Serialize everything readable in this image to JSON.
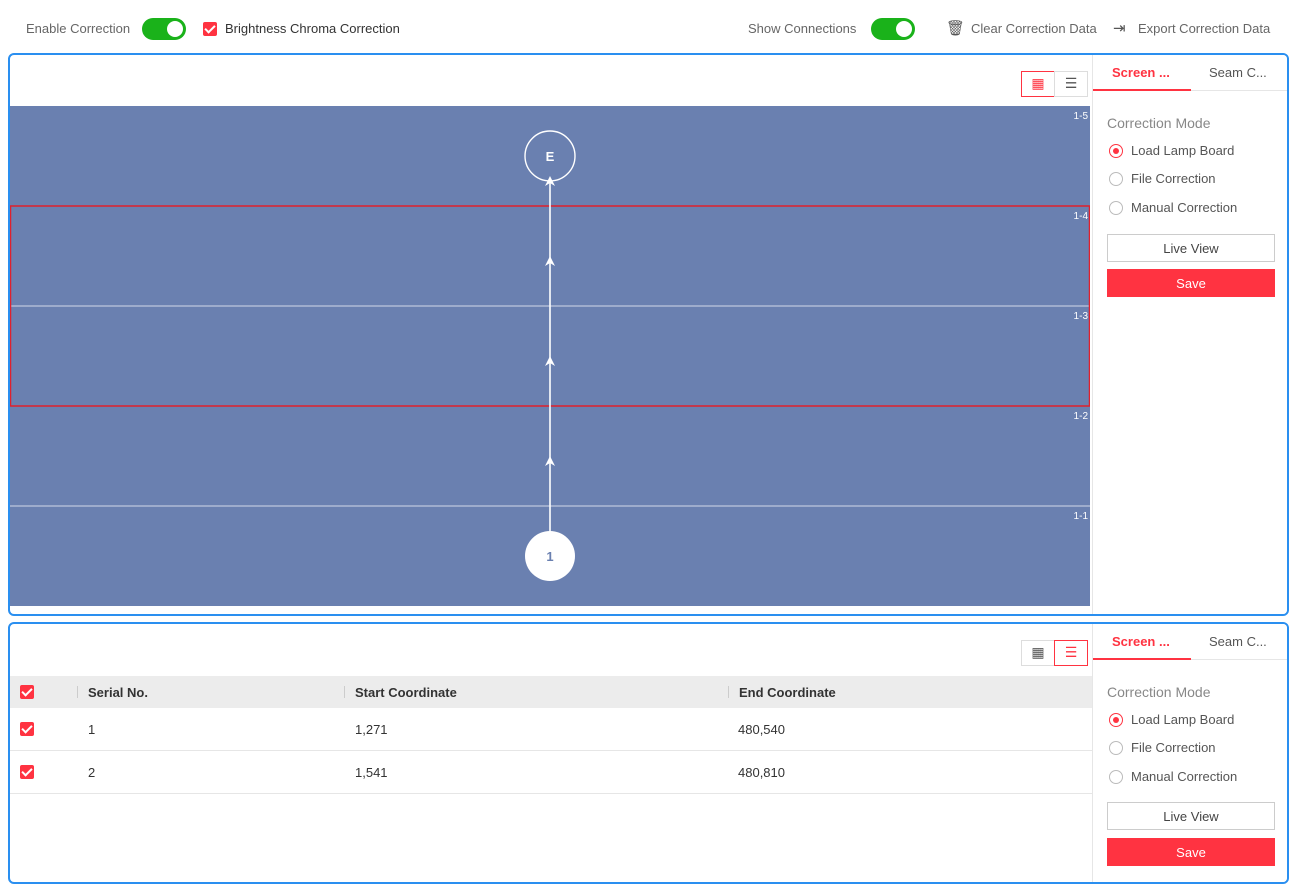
{
  "toolbar": {
    "enable_correction_label": "Enable Correction",
    "enable_correction_on": true,
    "brightness_label": "Brightness Chroma Correction",
    "brightness_checked": true,
    "show_connections_label": "Show Connections",
    "show_connections_on": true,
    "clear_label": "Clear Correction Data",
    "export_label": "Export Correction Data"
  },
  "canvas": {
    "rows": [
      "1-5",
      "1-4",
      "1-3",
      "1-2",
      "1-1"
    ],
    "start_node": "1",
    "end_node": "E",
    "selected_rows": [
      "1-4",
      "1-3"
    ]
  },
  "side_top": {
    "tabs": [
      "Screen ...",
      "Seam C..."
    ],
    "active_tab": 0,
    "mode_title": "Correction Mode",
    "options": [
      "Load Lamp Board",
      "File Correction",
      "Manual Correction"
    ],
    "selected_option": 0,
    "live_view_label": "Live View",
    "save_label": "Save"
  },
  "side_bottom": {
    "tabs": [
      "Screen ...",
      "Seam C..."
    ],
    "active_tab": 0,
    "mode_title": "Correction Mode",
    "options": [
      "Load Lamp Board",
      "File Correction",
      "Manual Correction"
    ],
    "selected_option": 0,
    "live_view_label": "Live View",
    "save_label": "Save"
  },
  "table": {
    "headers": [
      "Serial No.",
      "Start Coordinate",
      "End Coordinate"
    ],
    "rows": [
      {
        "serial": "1",
        "start": "1,271",
        "end": "480,540",
        "checked": true
      },
      {
        "serial": "2",
        "start": "1,541",
        "end": "480,810",
        "checked": true
      }
    ]
  },
  "colors": {
    "accent": "#ff3341",
    "toggle_on": "#1ab21a",
    "panel_border": "#2a8ff0",
    "canvas_fill": "#6a80b0"
  }
}
